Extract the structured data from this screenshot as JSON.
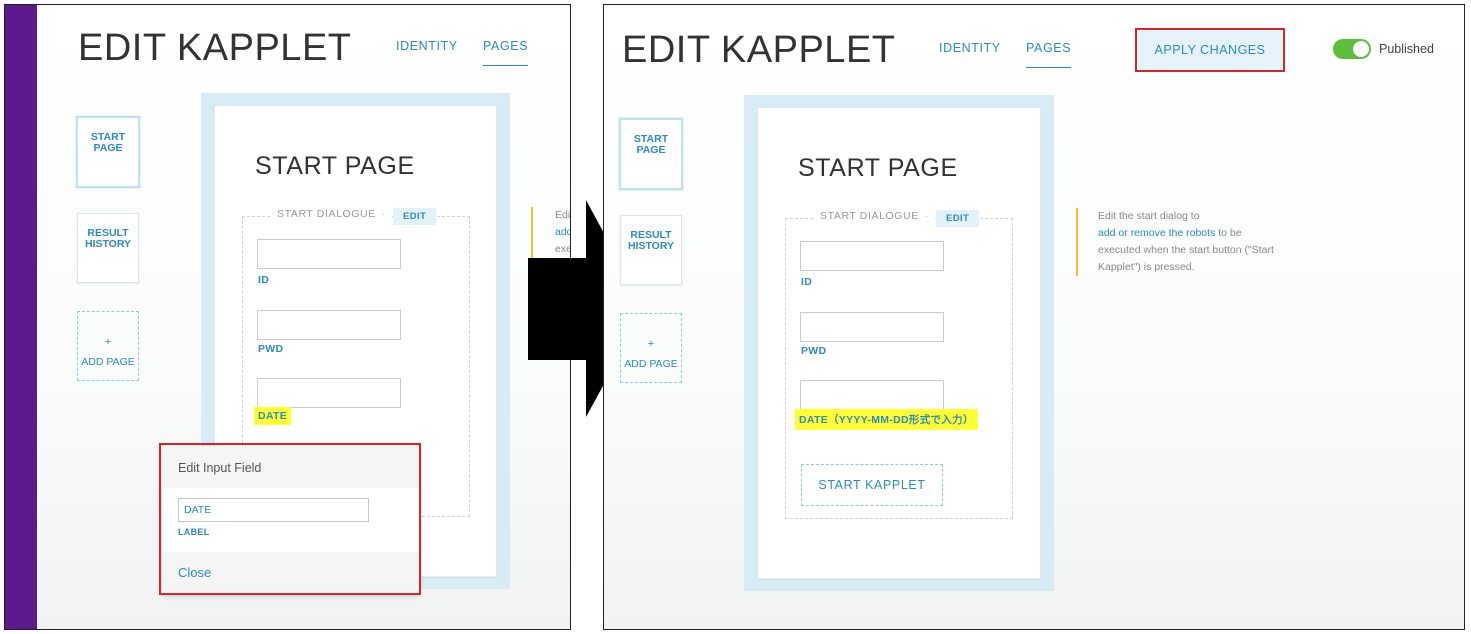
{
  "app": {
    "title": "EDIT KAPPLET"
  },
  "nav": {
    "identity": "IDENTITY",
    "pages": "PAGES"
  },
  "sidebar": {
    "start_page": "START PAGE",
    "result_history": "RESULT HISTORY",
    "add_page_plus": "+",
    "add_page": "ADD PAGE"
  },
  "page": {
    "title": "START PAGE",
    "dialogue_label": "START DIALOGUE",
    "dialogue_dot": "·",
    "edit_chip": "EDIT",
    "fields": {
      "id_label": "ID",
      "pwd_label": "PWD",
      "date_label_before": "DATE",
      "date_label_after": "DATE（YYYY-MM-DD形式で入力）"
    },
    "start_button": "START KAPPLET"
  },
  "hint": {
    "line1": "Edit the start dialog to",
    "link": "add or remove the robots",
    "line2": " to be",
    "line3": "executed when the start button (\"Start",
    "line4": "Kapplet\") is pressed.",
    "clip_line1": "Edi",
    "clip_line2": "add",
    "clip_line3": "exe"
  },
  "popup": {
    "title": "Edit Input Field",
    "input_value": "DATE",
    "input_label": "LABEL",
    "close": "Close"
  },
  "header_right": {
    "apply_changes": "APPLY CHANGES",
    "published": "Published"
  },
  "colors": {
    "accent": "#2b8cbf",
    "sidebar_purple": "#5c1a8e",
    "highlight": "#ffff33",
    "annotation_red": "#d8232a",
    "toggle_green": "#5cbf3c",
    "hint_bar": "#f2c230"
  }
}
